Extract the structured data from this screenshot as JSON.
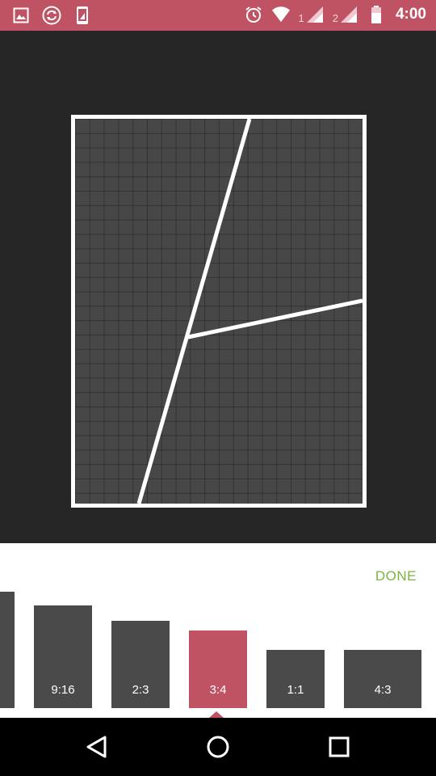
{
  "status_bar": {
    "time": "4:00",
    "sim1_label": "1",
    "sim2_label": "2",
    "icons": [
      "gallery-icon",
      "sync-icon",
      "phone-screenshot-icon",
      "alarm-icon",
      "wifi-icon",
      "signal-icon",
      "signal-icon",
      "battery-icon"
    ]
  },
  "editor": {
    "done_label": "DONE",
    "aspect_ratios": [
      {
        "label": ""
      },
      {
        "label": "9:16"
      },
      {
        "label": "2:3"
      },
      {
        "label": "3:4",
        "selected": true
      },
      {
        "label": "1:1"
      },
      {
        "label": "4:3"
      }
    ]
  },
  "colors": {
    "accent": "#c05363",
    "done": "#7cb342",
    "tile": "#4a4a4a",
    "canvas": "#262626",
    "frame_fill": "#474747"
  },
  "nav_bar": {
    "icons": [
      "back-icon",
      "home-icon",
      "recents-icon"
    ]
  }
}
